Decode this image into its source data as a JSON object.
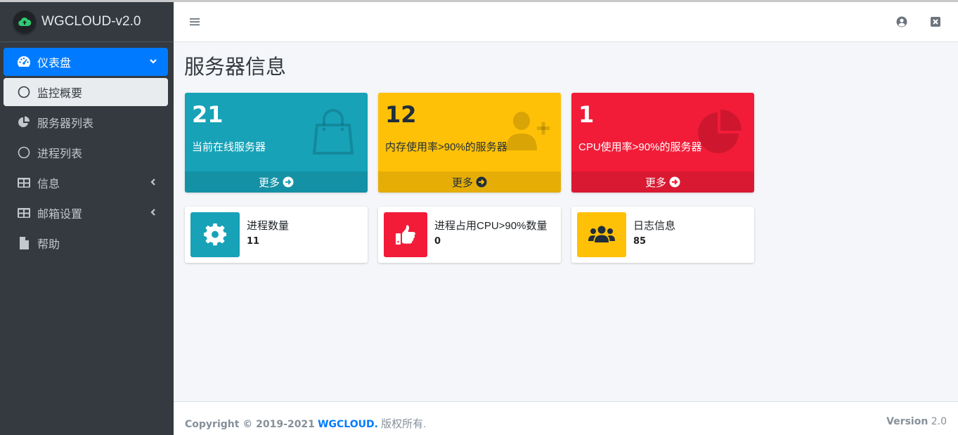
{
  "brand": {
    "title": "WGCLOUD-v2.0"
  },
  "sidebar": {
    "items": [
      {
        "label": "仪表盘"
      },
      {
        "label": "监控概要"
      },
      {
        "label": "服务器列表"
      },
      {
        "label": "进程列表"
      },
      {
        "label": "信息"
      },
      {
        "label": "邮箱设置"
      },
      {
        "label": "帮助"
      }
    ]
  },
  "page": {
    "title": "服务器信息"
  },
  "stat_boxes": [
    {
      "value": "21",
      "label": "当前在线服务器",
      "more": "更多",
      "color": "#17a2b8",
      "icon": "shopping-bag-icon"
    },
    {
      "value": "12",
      "label": "内存使用率>90%的服务器",
      "more": "更多",
      "color": "#ffc107",
      "icon": "user-plus-icon"
    },
    {
      "value": "1",
      "label": "CPU使用率>90%的服务器",
      "more": "更多",
      "color": "#f21c38",
      "icon": "pie-chart-icon"
    }
  ],
  "info_boxes": [
    {
      "title": "进程数量",
      "value": "11",
      "color": "#17a2b8",
      "icon": "gear-icon"
    },
    {
      "title": "进程占用CPU>90%数量",
      "value": "0",
      "color": "#f21c38",
      "icon": "thumbs-up-icon"
    },
    {
      "title": "日志信息",
      "value": "85",
      "color": "#ffc107",
      "icon": "users-icon"
    }
  ],
  "footer": {
    "copyright": "Copyright © 2019-2021",
    "brand": "WGCLOUD.",
    "rights": "版权所有.",
    "version_label": "Version",
    "version_value": "2.0"
  }
}
